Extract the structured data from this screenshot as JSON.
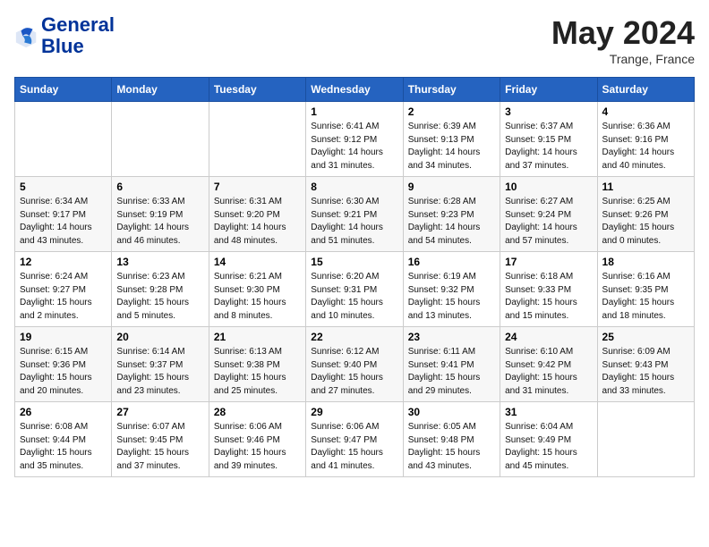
{
  "header": {
    "logo_line1": "General",
    "logo_line2": "Blue",
    "month_year": "May 2024",
    "location": "Trange, France"
  },
  "weekdays": [
    "Sunday",
    "Monday",
    "Tuesday",
    "Wednesday",
    "Thursday",
    "Friday",
    "Saturday"
  ],
  "weeks": [
    [
      {
        "day": "",
        "info": ""
      },
      {
        "day": "",
        "info": ""
      },
      {
        "day": "",
        "info": ""
      },
      {
        "day": "1",
        "info": "Sunrise: 6:41 AM\nSunset: 9:12 PM\nDaylight: 14 hours\nand 31 minutes."
      },
      {
        "day": "2",
        "info": "Sunrise: 6:39 AM\nSunset: 9:13 PM\nDaylight: 14 hours\nand 34 minutes."
      },
      {
        "day": "3",
        "info": "Sunrise: 6:37 AM\nSunset: 9:15 PM\nDaylight: 14 hours\nand 37 minutes."
      },
      {
        "day": "4",
        "info": "Sunrise: 6:36 AM\nSunset: 9:16 PM\nDaylight: 14 hours\nand 40 minutes."
      }
    ],
    [
      {
        "day": "5",
        "info": "Sunrise: 6:34 AM\nSunset: 9:17 PM\nDaylight: 14 hours\nand 43 minutes."
      },
      {
        "day": "6",
        "info": "Sunrise: 6:33 AM\nSunset: 9:19 PM\nDaylight: 14 hours\nand 46 minutes."
      },
      {
        "day": "7",
        "info": "Sunrise: 6:31 AM\nSunset: 9:20 PM\nDaylight: 14 hours\nand 48 minutes."
      },
      {
        "day": "8",
        "info": "Sunrise: 6:30 AM\nSunset: 9:21 PM\nDaylight: 14 hours\nand 51 minutes."
      },
      {
        "day": "9",
        "info": "Sunrise: 6:28 AM\nSunset: 9:23 PM\nDaylight: 14 hours\nand 54 minutes."
      },
      {
        "day": "10",
        "info": "Sunrise: 6:27 AM\nSunset: 9:24 PM\nDaylight: 14 hours\nand 57 minutes."
      },
      {
        "day": "11",
        "info": "Sunrise: 6:25 AM\nSunset: 9:26 PM\nDaylight: 15 hours\nand 0 minutes."
      }
    ],
    [
      {
        "day": "12",
        "info": "Sunrise: 6:24 AM\nSunset: 9:27 PM\nDaylight: 15 hours\nand 2 minutes."
      },
      {
        "day": "13",
        "info": "Sunrise: 6:23 AM\nSunset: 9:28 PM\nDaylight: 15 hours\nand 5 minutes."
      },
      {
        "day": "14",
        "info": "Sunrise: 6:21 AM\nSunset: 9:30 PM\nDaylight: 15 hours\nand 8 minutes."
      },
      {
        "day": "15",
        "info": "Sunrise: 6:20 AM\nSunset: 9:31 PM\nDaylight: 15 hours\nand 10 minutes."
      },
      {
        "day": "16",
        "info": "Sunrise: 6:19 AM\nSunset: 9:32 PM\nDaylight: 15 hours\nand 13 minutes."
      },
      {
        "day": "17",
        "info": "Sunrise: 6:18 AM\nSunset: 9:33 PM\nDaylight: 15 hours\nand 15 minutes."
      },
      {
        "day": "18",
        "info": "Sunrise: 6:16 AM\nSunset: 9:35 PM\nDaylight: 15 hours\nand 18 minutes."
      }
    ],
    [
      {
        "day": "19",
        "info": "Sunrise: 6:15 AM\nSunset: 9:36 PM\nDaylight: 15 hours\nand 20 minutes."
      },
      {
        "day": "20",
        "info": "Sunrise: 6:14 AM\nSunset: 9:37 PM\nDaylight: 15 hours\nand 23 minutes."
      },
      {
        "day": "21",
        "info": "Sunrise: 6:13 AM\nSunset: 9:38 PM\nDaylight: 15 hours\nand 25 minutes."
      },
      {
        "day": "22",
        "info": "Sunrise: 6:12 AM\nSunset: 9:40 PM\nDaylight: 15 hours\nand 27 minutes."
      },
      {
        "day": "23",
        "info": "Sunrise: 6:11 AM\nSunset: 9:41 PM\nDaylight: 15 hours\nand 29 minutes."
      },
      {
        "day": "24",
        "info": "Sunrise: 6:10 AM\nSunset: 9:42 PM\nDaylight: 15 hours\nand 31 minutes."
      },
      {
        "day": "25",
        "info": "Sunrise: 6:09 AM\nSunset: 9:43 PM\nDaylight: 15 hours\nand 33 minutes."
      }
    ],
    [
      {
        "day": "26",
        "info": "Sunrise: 6:08 AM\nSunset: 9:44 PM\nDaylight: 15 hours\nand 35 minutes."
      },
      {
        "day": "27",
        "info": "Sunrise: 6:07 AM\nSunset: 9:45 PM\nDaylight: 15 hours\nand 37 minutes."
      },
      {
        "day": "28",
        "info": "Sunrise: 6:06 AM\nSunset: 9:46 PM\nDaylight: 15 hours\nand 39 minutes."
      },
      {
        "day": "29",
        "info": "Sunrise: 6:06 AM\nSunset: 9:47 PM\nDaylight: 15 hours\nand 41 minutes."
      },
      {
        "day": "30",
        "info": "Sunrise: 6:05 AM\nSunset: 9:48 PM\nDaylight: 15 hours\nand 43 minutes."
      },
      {
        "day": "31",
        "info": "Sunrise: 6:04 AM\nSunset: 9:49 PM\nDaylight: 15 hours\nand 45 minutes."
      },
      {
        "day": "",
        "info": ""
      }
    ]
  ]
}
